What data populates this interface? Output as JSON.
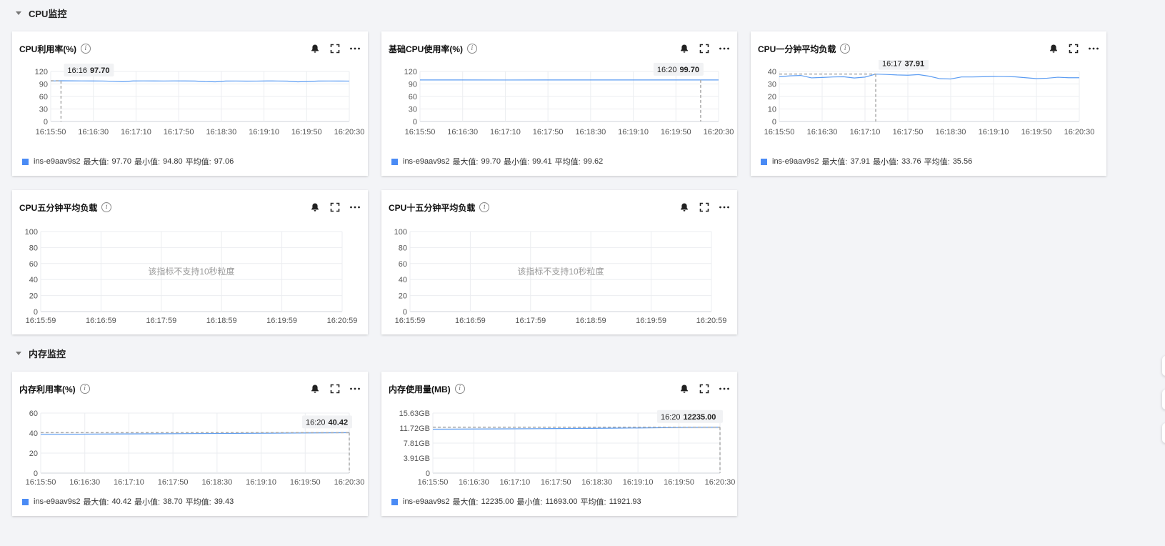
{
  "sections": [
    {
      "title": "CPU监控"
    },
    {
      "title": "内存监控"
    }
  ],
  "cards": [
    {
      "title": "CPU利用率(%)",
      "yticks": [
        "120",
        "90",
        "60",
        "30",
        "0"
      ],
      "xticks": [
        "16:15:50",
        "16:16:30",
        "16:17:10",
        "16:17:50",
        "16:18:30",
        "16:19:10",
        "16:19:50",
        "16:20:30"
      ],
      "tooltip": {
        "time": "16:16",
        "value": "97.70"
      },
      "legend": {
        "series": "ins-e9aav9s2",
        "max_label": "最大值:",
        "max": "97.70",
        "min_label": "最小值:",
        "min": "94.80",
        "avg_label": "平均值:",
        "avg": "97.06"
      }
    },
    {
      "title": "基础CPU使用率(%)",
      "yticks": [
        "120",
        "90",
        "60",
        "30",
        "0"
      ],
      "xticks": [
        "16:15:50",
        "16:16:30",
        "16:17:10",
        "16:17:50",
        "16:18:30",
        "16:19:10",
        "16:19:50",
        "16:20:30"
      ],
      "tooltip": {
        "time": "16:20",
        "value": "99.70"
      },
      "legend": {
        "series": "ins-e9aav9s2",
        "max_label": "最大值:",
        "max": "99.70",
        "min_label": "最小值:",
        "min": "99.41",
        "avg_label": "平均值:",
        "avg": "99.62"
      }
    },
    {
      "title": "CPU一分钟平均负载",
      "yticks": [
        "40",
        "30",
        "20",
        "10",
        "0"
      ],
      "xticks": [
        "16:15:50",
        "16:16:30",
        "16:17:10",
        "16:17:50",
        "16:18:30",
        "16:19:10",
        "16:19:50",
        "16:20:30"
      ],
      "tooltip": {
        "time": "16:17",
        "value": "37.91"
      },
      "legend": {
        "series": "ins-e9aav9s2",
        "max_label": "最大值:",
        "max": "37.91",
        "min_label": "最小值:",
        "min": "33.76",
        "avg_label": "平均值:",
        "avg": "35.56"
      }
    },
    {
      "title": "CPU五分钟平均负载",
      "yticks": [
        "100",
        "80",
        "60",
        "40",
        "20",
        "0"
      ],
      "xticks": [
        "16:15:59",
        "16:16:59",
        "16:17:59",
        "16:18:59",
        "16:19:59",
        "16:20:59"
      ],
      "empty_message": "该指标不支持10秒粒度"
    },
    {
      "title": "CPU十五分钟平均负载",
      "yticks": [
        "100",
        "80",
        "60",
        "40",
        "20",
        "0"
      ],
      "xticks": [
        "16:15:59",
        "16:16:59",
        "16:17:59",
        "16:18:59",
        "16:19:59",
        "16:20:59"
      ],
      "empty_message": "该指标不支持10秒粒度"
    },
    {
      "title": "内存利用率(%)",
      "yticks": [
        "60",
        "40",
        "20",
        "0"
      ],
      "xticks": [
        "16:15:50",
        "16:16:30",
        "16:17:10",
        "16:17:50",
        "16:18:30",
        "16:19:10",
        "16:19:50",
        "16:20:30"
      ],
      "tooltip": {
        "time": "16:20",
        "value": "40.42"
      },
      "legend": {
        "series": "ins-e9aav9s2",
        "max_label": "最大值:",
        "max": "40.42",
        "min_label": "最小值:",
        "min": "38.70",
        "avg_label": "平均值:",
        "avg": "39.43"
      }
    },
    {
      "title": "内存使用量(MB)",
      "yticks": [
        "15.63GB",
        "11.72GB",
        "7.81GB",
        "3.91GB",
        "0"
      ],
      "xticks": [
        "16:15:50",
        "16:16:30",
        "16:17:10",
        "16:17:50",
        "16:18:30",
        "16:19:10",
        "16:19:50",
        "16:20:30"
      ],
      "tooltip": {
        "time": "16:20",
        "value": "12235.00"
      },
      "legend": {
        "series": "ins-e9aav9s2",
        "max_label": "最大值:",
        "max": "12235.00",
        "min_label": "最小值:",
        "min": "11693.00",
        "avg_label": "平均值:",
        "avg": "11921.93"
      }
    }
  ],
  "colors": {
    "line": "#5b9cf2",
    "legend": "#4a8bf5",
    "grid": "#ebedf0",
    "crosshair": "#aaaaaa"
  },
  "icons": [
    "bell-icon",
    "fullscreen-icon",
    "more-icon",
    "info-icon",
    "caret-down-icon"
  ],
  "chart_data": [
    {
      "type": "line",
      "title": "CPU利用率(%)",
      "ylim": [
        0,
        120
      ],
      "x": [
        "16:15:50",
        "16:16:00",
        "16:16:10",
        "16:16:20",
        "16:16:30",
        "16:16:40",
        "16:16:50",
        "16:17:00",
        "16:17:10",
        "16:17:20",
        "16:17:30",
        "16:17:40",
        "16:17:50",
        "16:18:00",
        "16:18:10",
        "16:18:20",
        "16:18:30",
        "16:18:40",
        "16:18:50",
        "16:19:00",
        "16:19:10",
        "16:19:20",
        "16:19:30",
        "16:19:40",
        "16:19:50",
        "16:20:00",
        "16:20:10",
        "16:20:20",
        "16:20:30",
        "16:20:40"
      ],
      "series": [
        {
          "name": "ins-e9aav9s2",
          "values": [
            97.2,
            97.7,
            97.5,
            97.4,
            97.3,
            97.2,
            96.5,
            95.6,
            97.3,
            97.4,
            97.3,
            97.2,
            97.4,
            97.3,
            97.1,
            95.8,
            95.2,
            97.1,
            97.2,
            96.9,
            97.0,
            97.3,
            97.2,
            96.9,
            95.2,
            96.0,
            97.1,
            97.2,
            97.1,
            97.0
          ]
        }
      ]
    },
    {
      "type": "line",
      "title": "基础CPU使用率(%)",
      "ylim": [
        0,
        120
      ],
      "x": [
        "16:15:50",
        "16:16:30",
        "16:17:10",
        "16:17:50",
        "16:18:30",
        "16:19:10",
        "16:19:50",
        "16:20:30"
      ],
      "series": [
        {
          "name": "ins-e9aav9s2",
          "values": [
            99.7,
            99.6,
            99.5,
            99.6,
            99.6,
            99.7,
            99.6,
            99.7
          ]
        }
      ]
    },
    {
      "type": "line",
      "title": "CPU一分钟平均负载",
      "ylim": [
        0,
        40
      ],
      "x": [
        "16:15:50",
        "16:16:00",
        "16:16:10",
        "16:16:20",
        "16:16:30",
        "16:16:40",
        "16:16:50",
        "16:17:00",
        "16:17:10",
        "16:17:20",
        "16:17:30",
        "16:17:40",
        "16:17:50",
        "16:18:00",
        "16:18:10",
        "16:18:20",
        "16:18:30",
        "16:18:40",
        "16:18:50",
        "16:19:00",
        "16:19:10",
        "16:19:20",
        "16:19:30",
        "16:19:40",
        "16:19:50",
        "16:20:00",
        "16:20:10",
        "16:20:20",
        "16:20:30"
      ],
      "series": [
        {
          "name": "ins-e9aav9s2",
          "values": [
            35.8,
            36.5,
            36.8,
            34.9,
            35.2,
            35.6,
            35.8,
            34.8,
            35.5,
            37.9,
            37.6,
            37.2,
            37.0,
            37.5,
            36.2,
            34.2,
            34.0,
            35.6,
            35.6,
            35.8,
            36.0,
            35.9,
            35.7,
            35.0,
            34.3,
            34.6,
            35.4,
            35.0,
            35.0
          ]
        }
      ]
    },
    {
      "type": "line",
      "title": "CPU五分钟平均负载",
      "ylim": [
        0,
        100
      ],
      "x": [
        "16:15:59",
        "16:16:59",
        "16:17:59",
        "16:18:59",
        "16:19:59",
        "16:20:59"
      ],
      "series": []
    },
    {
      "type": "line",
      "title": "CPU十五分钟平均负载",
      "ylim": [
        0,
        100
      ],
      "x": [
        "16:15:59",
        "16:16:59",
        "16:17:59",
        "16:18:59",
        "16:19:59",
        "16:20:59"
      ],
      "series": []
    },
    {
      "type": "line",
      "title": "内存利用率(%)",
      "ylim": [
        0,
        60
      ],
      "x": [
        "16:15:50",
        "16:16:30",
        "16:17:10",
        "16:17:50",
        "16:18:30",
        "16:19:10",
        "16:19:50",
        "16:20:30",
        "16:20:40"
      ],
      "series": [
        {
          "name": "ins-e9aav9s2",
          "values": [
            38.7,
            38.9,
            39.1,
            39.3,
            39.5,
            39.7,
            39.9,
            40.2,
            40.42
          ]
        }
      ]
    },
    {
      "type": "line",
      "title": "内存使用量(MB)",
      "ylim": [
        0,
        16000
      ],
      "x": [
        "16:15:50",
        "16:16:30",
        "16:17:10",
        "16:17:50",
        "16:18:30",
        "16:19:10",
        "16:19:50",
        "16:20:30",
        "16:20:40"
      ],
      "series": [
        {
          "name": "ins-e9aav9s2",
          "values": [
            11693,
            11740,
            11790,
            11850,
            11910,
            11980,
            12060,
            12180,
            12235
          ]
        }
      ]
    }
  ]
}
